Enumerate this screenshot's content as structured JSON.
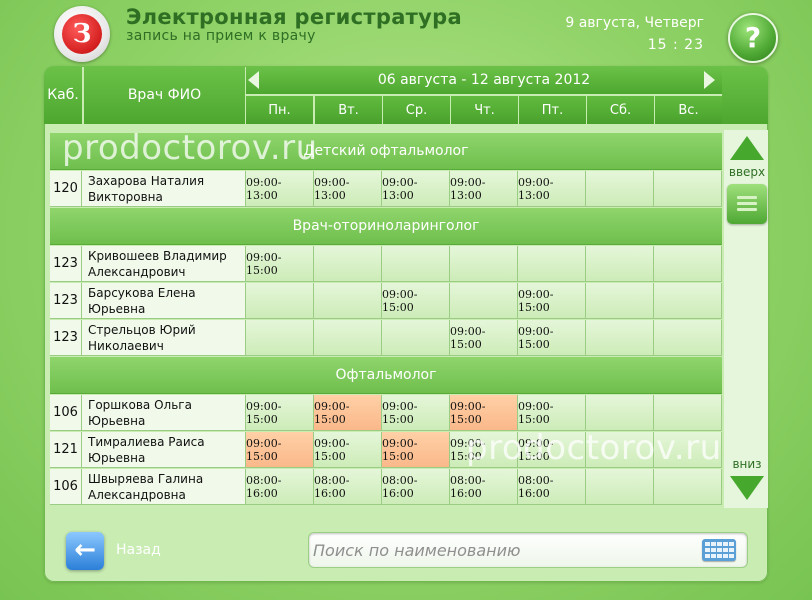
{
  "header": {
    "logo_letter": "З",
    "title": "Электронная регистратура",
    "subtitle": "запись на прием к врачу",
    "date": "9 августа, Четверг",
    "time": "15 : 23",
    "help_label": "?"
  },
  "table": {
    "kab_header": "Каб.",
    "fio_header": "Врач ФИО",
    "week_range": "06 августа - 12 августа 2012",
    "days": [
      "Пн.",
      "Вт.",
      "Ср.",
      "Чт.",
      "Пт.",
      "Сб.",
      "Вс."
    ],
    "sections": [
      {
        "title": "Детский офтальмолог",
        "doctors": [
          {
            "kab": "120",
            "name": "Захарова Наталия\nВикторовна",
            "slots": [
              "09:00-13:00",
              "09:00-13:00",
              "09:00-13:00",
              "09:00-13:00",
              "09:00-13:00",
              "",
              ""
            ],
            "highlight": [
              false,
              false,
              false,
              false,
              false,
              false,
              false
            ]
          }
        ]
      },
      {
        "title": "Врач-оториноларинголог",
        "doctors": [
          {
            "kab": "123",
            "name": "Кривошеев Владимир\nАлександрович",
            "slots": [
              "09:00-15:00",
              "",
              "",
              "",
              "",
              "",
              ""
            ],
            "highlight": [
              false,
              false,
              false,
              false,
              false,
              false,
              false
            ]
          },
          {
            "kab": "123",
            "name": "Барсукова Елена\nЮрьевна",
            "slots": [
              "",
              "",
              "09:00-15:00",
              "",
              "09:00-15:00",
              "",
              ""
            ],
            "highlight": [
              false,
              false,
              false,
              false,
              false,
              false,
              false
            ]
          },
          {
            "kab": "123",
            "name": "Стрельцов Юрий\nНиколаевич",
            "slots": [
              "",
              "",
              "",
              "09:00-15:00",
              "09:00-15:00",
              "",
              ""
            ],
            "highlight": [
              false,
              false,
              false,
              false,
              false,
              false,
              false
            ]
          }
        ]
      },
      {
        "title": "Офтальмолог",
        "doctors": [
          {
            "kab": "106",
            "name": "Горшкова Ольга\nЮрьевна",
            "slots": [
              "09:00-15:00",
              "09:00-15:00",
              "09:00-15:00",
              "09:00-15:00",
              "09:00-15:00",
              "",
              ""
            ],
            "highlight": [
              false,
              true,
              false,
              true,
              false,
              false,
              false
            ]
          },
          {
            "kab": "121",
            "name": "Тимралиева Раиса\nЮрьевна",
            "slots": [
              "09:00-15:00",
              "09:00-15:00",
              "09:00-15:00",
              "09:00-15:00",
              "09:00-15:00",
              "",
              ""
            ],
            "highlight": [
              true,
              false,
              true,
              false,
              false,
              false,
              false
            ]
          },
          {
            "kab": "106",
            "name": "Швыряева Галина\nАлександровна",
            "slots": [
              "08:00-16:00",
              "08:00-16:00",
              "08:00-16:00",
              "08:00-16:00",
              "08:00-16:00",
              "",
              ""
            ],
            "highlight": [
              false,
              false,
              false,
              false,
              false,
              false,
              false
            ]
          }
        ]
      }
    ]
  },
  "scroll": {
    "up_label": "вверх",
    "down_label": "вниз"
  },
  "footer": {
    "back_label": "Назад",
    "search_placeholder": "Поиск по наименованию"
  },
  "watermark": "prodoctorov.ru",
  "colors": {
    "highlight": "#fab88a",
    "accent_green": "#4da72f"
  }
}
